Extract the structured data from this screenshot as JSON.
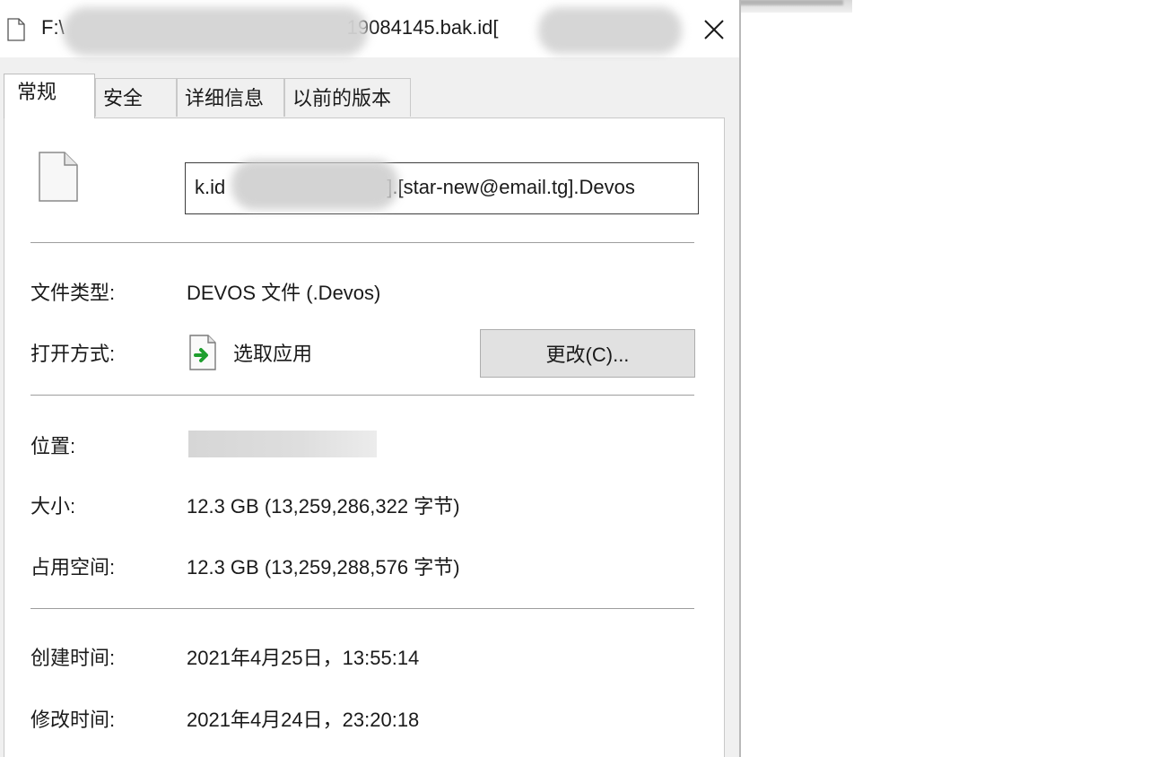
{
  "window": {
    "title_prefix": "F:\\",
    "title_suffix": "19084145.bak.id["
  },
  "tabs": [
    {
      "label": "常规",
      "active": true
    },
    {
      "label": "安全",
      "active": false
    },
    {
      "label": "详细信息",
      "active": false
    },
    {
      "label": "以前的版本",
      "active": false
    }
  ],
  "file": {
    "name_prefix": "k.id",
    "name_suffix": "].[star-new@email.tg].Devos"
  },
  "props": {
    "type_label": "文件类型:",
    "type_value": "DEVOS 文件 (.Devos)",
    "open_label": "打开方式:",
    "open_value": "选取应用",
    "change_button": "更改(C)...",
    "location_label": "位置:",
    "size_label": "大小:",
    "size_value": "12.3 GB (13,259,286,322 字节)",
    "disk_label": "占用空间:",
    "disk_value": "12.3 GB (13,259,288,576 字节)",
    "created_label": "创建时间:",
    "created_value": "2021年4月25日，13:55:14",
    "modified_label": "修改时间:",
    "modified_value": "2021年4月24日，23:20:18"
  },
  "icons": {
    "title": "file-icon",
    "close": "close-icon",
    "big_file": "file-icon",
    "app": "app-picker-icon"
  }
}
